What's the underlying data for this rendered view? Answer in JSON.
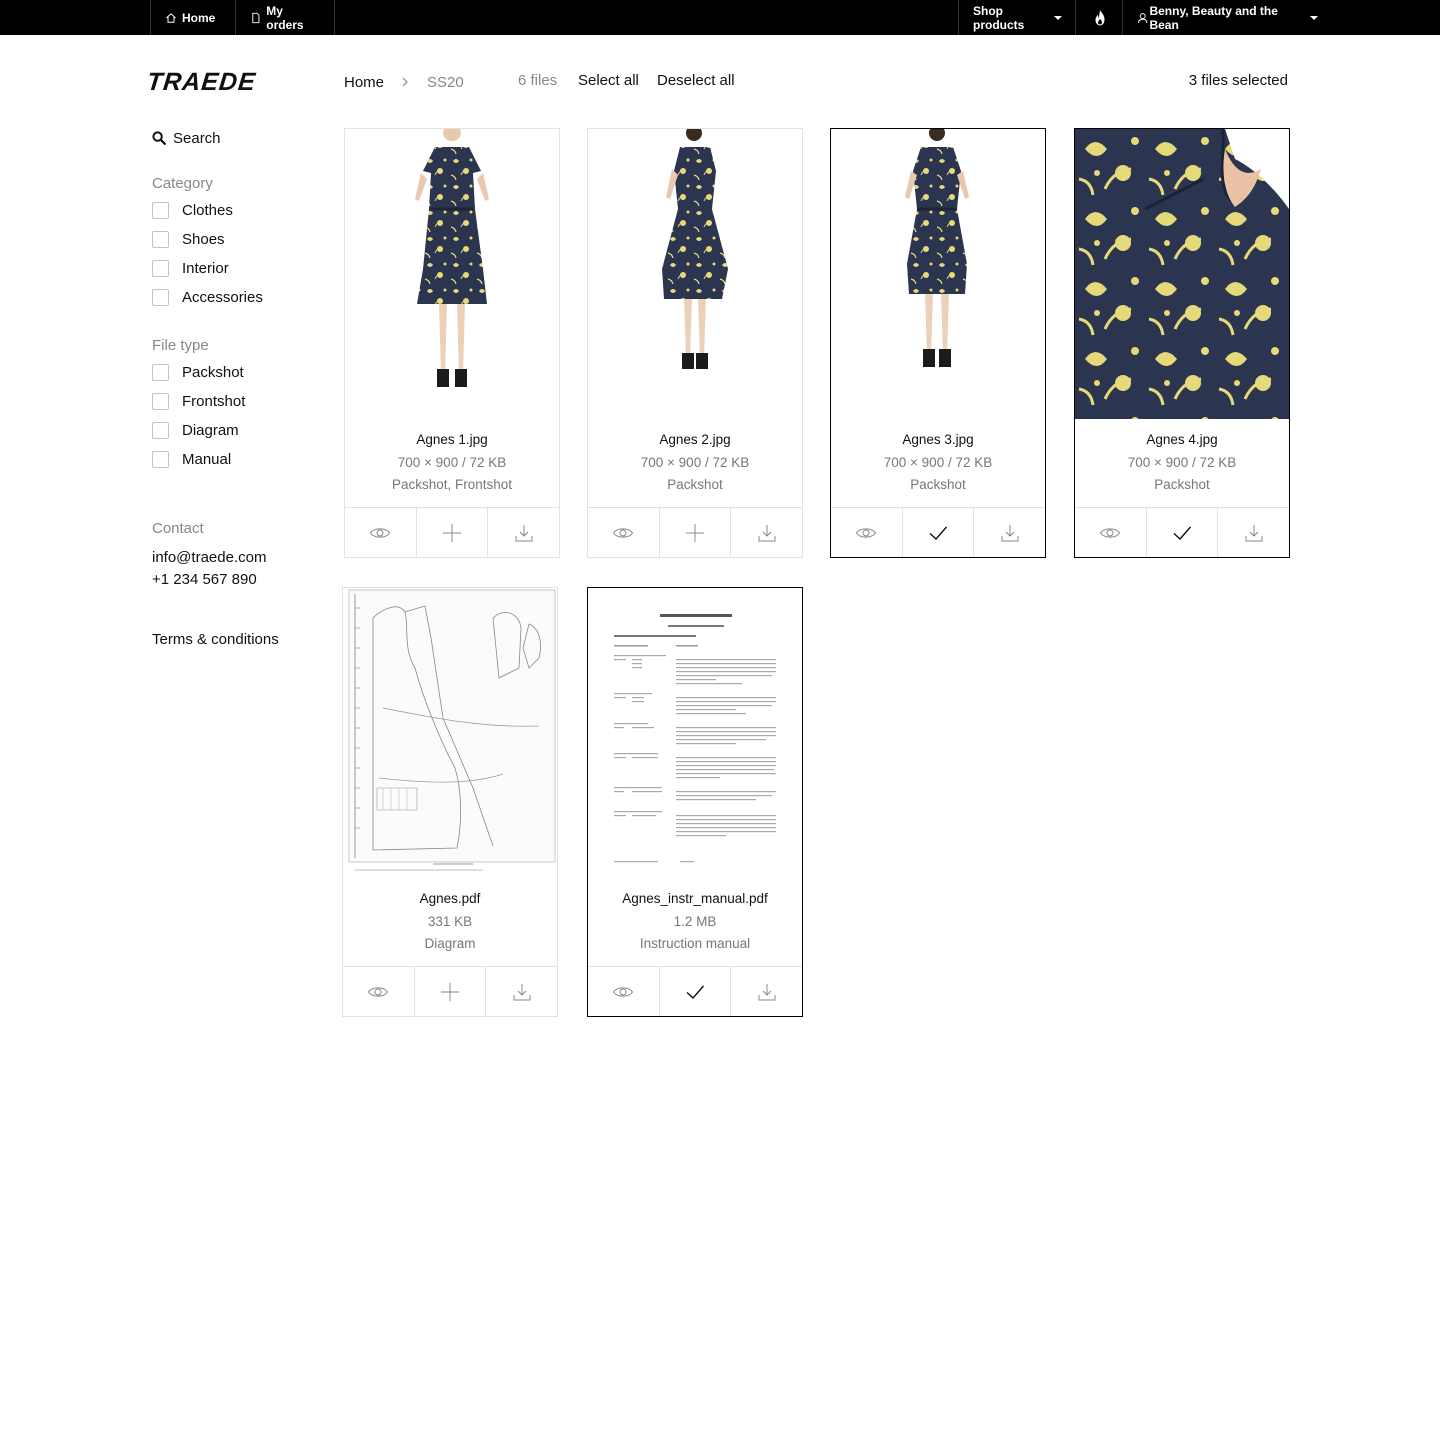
{
  "topbar": {
    "home_label": "Home",
    "orders_label": "My orders",
    "shop_label": "Shop products",
    "account_label": "Benny, Beauty and the Bean"
  },
  "brand": {
    "logo_text": "TRAEDE"
  },
  "breadcrumb": {
    "home": "Home",
    "current": "SS20"
  },
  "header": {
    "files_count": "6 files",
    "select_all": "Select all",
    "deselect_all": "Deselect all",
    "selected_count": "3 files selected"
  },
  "sidebar": {
    "search_label": "Search",
    "category_title": "Category",
    "categories": [
      "Clothes",
      "Shoes",
      "Interior",
      "Accessories"
    ],
    "filetype_title": "File type",
    "filetypes": [
      "Packshot",
      "Frontshot",
      "Diagram",
      "Manual"
    ],
    "contact_title": "Contact",
    "email": "info@traede.com",
    "phone": "+1 234 567 890",
    "terms": "Terms & conditions"
  },
  "files": [
    {
      "name": "Agnes 1.jpg",
      "meta": "700 × 900 / 72 KB",
      "type": "Packshot, Frontshot",
      "selected": false,
      "thumb": "dress-front"
    },
    {
      "name": "Agnes 2.jpg",
      "meta": "700 × 900 / 72 KB",
      "type": "Packshot",
      "selected": false,
      "thumb": "dress-side"
    },
    {
      "name": "Agnes 3.jpg",
      "meta": "700 × 900 / 72 KB",
      "type": "Packshot",
      "selected": true,
      "thumb": "dress-back"
    },
    {
      "name": "Agnes 4.jpg",
      "meta": "700 × 900 / 72 KB",
      "type": "Packshot",
      "selected": true,
      "thumb": "fabric-detail"
    },
    {
      "name": "Agnes.pdf",
      "meta": "331 KB",
      "type": "Diagram",
      "selected": false,
      "thumb": "sewing-pattern"
    },
    {
      "name": "Agnes_instr_manual.pdf",
      "meta": "1.2 MB",
      "type": "Instruction manual",
      "selected": true,
      "thumb": "document-page"
    }
  ],
  "colors": {
    "topbar": "#000000",
    "fabric_navy": "#2b3550",
    "fabric_yellow": "#e5d97a",
    "muted_text": "#777777"
  },
  "icons": {
    "view": "eye-icon",
    "add": "plus-icon",
    "added": "check-icon",
    "download": "download-icon"
  }
}
